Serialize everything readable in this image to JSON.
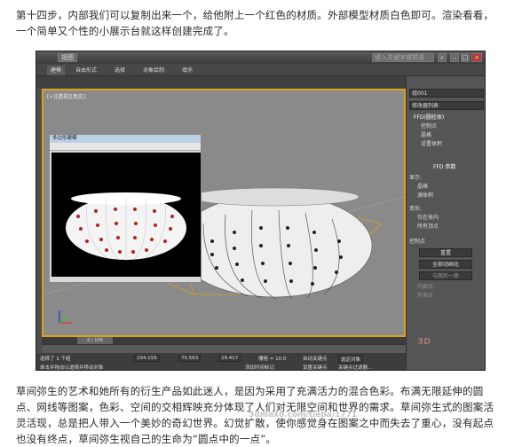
{
  "intro_text": "第十四步，内部我们可以复制出来一个，给他附上一个红色的材质。外部模型材质白色即可。渲染看看，一个简单又个性的小展示台就这样创建完成了。",
  "outro_text": "草间弥生的艺术和她所有的衍生产品如此迷人，是因为采用了充满活力的混合色彩。布满无限延伸的圆点、网线等图案，色彩、空间的交相辉映充分体现了人们对无限空间和世界的需求。草间弥生式的图案活灵活现，总是把人带入一个美妙的奇幻世界。幻觉扩散，使你感觉身在图案之中而失去了重心，没有起点也没有终点，草间弥生视自己的生命为“圆点中的一点”。",
  "app": {
    "ribbon_tabs": [
      "建模",
      "自由形式",
      "选择",
      "对象绘制",
      "填充"
    ],
    "search_placeholder": "键入关键字或短语",
    "toolbar_view_select": "视图",
    "viewport_label": "[+][透视][真实]",
    "render_window_title": "多边形建模",
    "render_window_subtitle": "透视, 帧 0 (1:1)",
    "command_panel": {
      "object_name": "组001",
      "modifier_list": "修改器列表",
      "stack": [
        "FFD(圆柱体)",
        "控制点",
        "晶格",
        "设置体积"
      ],
      "rollout_title": "FFD 参数",
      "display_label": "显示:",
      "display_options": [
        "晶格",
        "源体积"
      ],
      "deform_label": "变形:",
      "deform_options": [
        "仅在体内",
        "所有顶点"
      ],
      "control_points_label": "控制点",
      "buttons": [
        "重置",
        "全部动画化",
        "与图形一致"
      ],
      "checkbox_options": [
        "内部点",
        "外部点"
      ]
    },
    "timeline": {
      "frame_display": "0 / 100"
    },
    "status": {
      "selected": "选择了 1 个组",
      "hint": "单击并拖动以选择并移动对象",
      "x_value": "234.155",
      "y_value": "75.563",
      "z_value": "29.417",
      "grid": "栅格 = 10.0",
      "auto_key": "自动关键点",
      "set_key": "设置关键点",
      "selected_set": "选定对象",
      "key_filter": "关键点过滤器...",
      "add_time_tag": "添加时间标记"
    }
  },
  "watermark_text": "3dmax8.com/tieba/1771",
  "colors": {
    "viewport_bg": "#8a8a8a",
    "selection_border": "#d9a21b",
    "ui_dark": "#3d3d3d"
  }
}
